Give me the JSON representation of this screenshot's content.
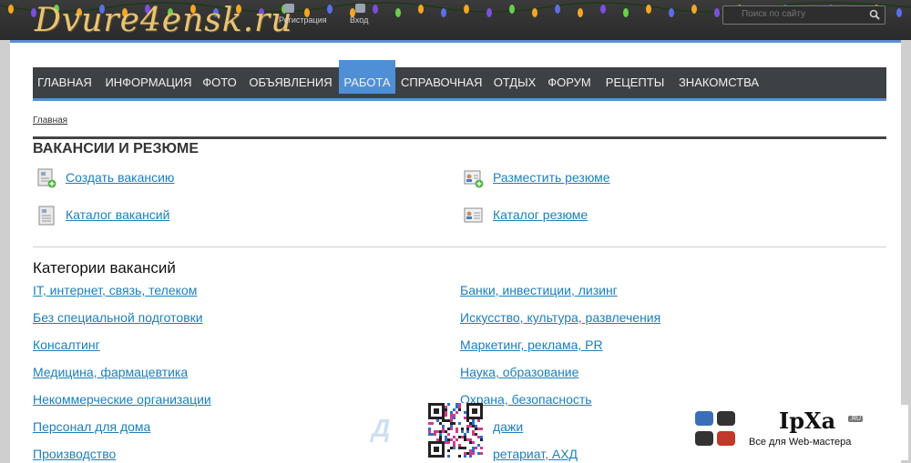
{
  "header": {
    "logo_text": "Dvure4ensk.ru",
    "register_label": "Регистрация",
    "login_label": "Вход",
    "search_placeholder": "Поиск по сайту"
  },
  "nav": {
    "items": [
      {
        "label": "ГЛАВНАЯ"
      },
      {
        "label": "ИНФОРМАЦИЯ"
      },
      {
        "label": "ФОТО"
      },
      {
        "label": "ОБЪЯВЛЕНИЯ"
      },
      {
        "label": "РАБОТА",
        "active": true
      },
      {
        "label": "СПРАВОЧНАЯ"
      },
      {
        "label": "ОТДЫХ"
      },
      {
        "label": "ФОРУМ"
      },
      {
        "label": "РЕЦЕПТЫ"
      },
      {
        "label": "ЗНАКОМСТВА"
      }
    ]
  },
  "breadcrumb": "Главная",
  "section_title": "ВАКАНСИИ И РЕЗЮМЕ",
  "actions": {
    "create_vacancy": "Создать вакансию",
    "post_resume": "Разместить резюме",
    "vacancy_catalog": "Каталог вакансий",
    "resume_catalog": "Каталог резюме"
  },
  "categories_title": "Категории вакансий",
  "categories_left": [
    "IT, интернет, связь, телеком",
    "Без специальной подготовки",
    "Консалтинг",
    "Медицина, фармацевтика",
    "Некоммерческие организации",
    "Персонал для дома",
    "Производство"
  ],
  "categories_right": [
    "Банки, инвестиции, лизинг",
    "Искусство, культура, развлечения",
    "Маркетинг, реклама, PR",
    "Наука, образование",
    "Охрана, безопасность",
    "дажи",
    "ретариат, АХД"
  ],
  "overlay": {
    "ipxa_brand": "IpXa",
    "ipxa_ru": ".RU",
    "ipxa_tagline": "Все для Web-мастера"
  },
  "colors": {
    "accent": "#5a8fd4",
    "link": "#1a7fbf",
    "nav_bg": "#3d4045"
  }
}
